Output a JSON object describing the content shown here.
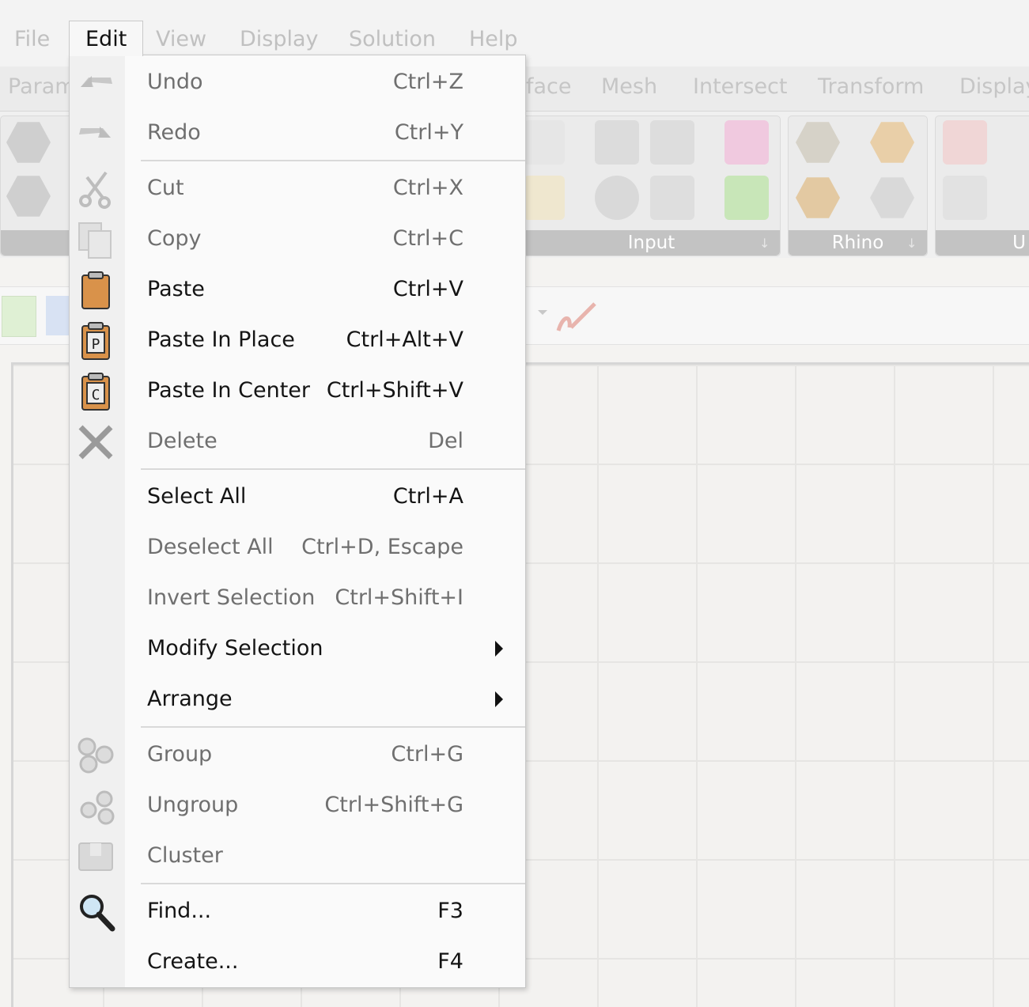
{
  "menubar": {
    "items": [
      "File",
      "Edit",
      "View",
      "Display",
      "Solution",
      "Help"
    ]
  },
  "tabs": {
    "items": [
      "Param",
      "face",
      "Mesh",
      "Intersect",
      "Transform",
      "Display"
    ]
  },
  "ribbon": {
    "panels": [
      "Input",
      "Rhino",
      "U"
    ]
  },
  "edit_menu": {
    "items": [
      {
        "label": "Undo",
        "shortcut": "Ctrl+Z",
        "enabled": false,
        "icon": "undo-icon"
      },
      {
        "label": "Redo",
        "shortcut": "Ctrl+Y",
        "enabled": false,
        "icon": "redo-icon"
      },
      {
        "label": "Cut",
        "shortcut": "Ctrl+X",
        "enabled": false,
        "icon": "scissors-icon"
      },
      {
        "label": "Copy",
        "shortcut": "Ctrl+C",
        "enabled": false,
        "icon": "copy-icon"
      },
      {
        "label": "Paste",
        "shortcut": "Ctrl+V",
        "enabled": true,
        "icon": "clipboard-icon"
      },
      {
        "label": "Paste In Place",
        "shortcut": "Ctrl+Alt+V",
        "enabled": true,
        "icon": "clipboard-p-icon"
      },
      {
        "label": "Paste In Center",
        "shortcut": "Ctrl+Shift+V",
        "enabled": true,
        "icon": "clipboard-c-icon"
      },
      {
        "label": "Delete",
        "shortcut": "Del",
        "enabled": false,
        "icon": "delete-x-icon"
      },
      {
        "label": "Select All",
        "shortcut": "Ctrl+A",
        "enabled": true,
        "icon": ""
      },
      {
        "label": "Deselect All",
        "shortcut": "Ctrl+D, Escape",
        "enabled": false,
        "icon": ""
      },
      {
        "label": "Invert Selection",
        "shortcut": "Ctrl+Shift+I",
        "enabled": false,
        "icon": ""
      },
      {
        "label": "Modify Selection",
        "shortcut": "",
        "enabled": true,
        "icon": "",
        "submenu": true
      },
      {
        "label": "Arrange",
        "shortcut": "",
        "enabled": true,
        "icon": "",
        "submenu": true
      },
      {
        "label": "Group",
        "shortcut": "Ctrl+G",
        "enabled": false,
        "icon": "group-icon"
      },
      {
        "label": "Ungroup",
        "shortcut": "Ctrl+Shift+G",
        "enabled": false,
        "icon": "ungroup-icon"
      },
      {
        "label": "Cluster",
        "shortcut": "",
        "enabled": false,
        "icon": "cluster-box-icon"
      },
      {
        "label": "Find...",
        "shortcut": "F3",
        "enabled": true,
        "icon": "magnifier-icon"
      },
      {
        "label": "Create...",
        "shortcut": "F4",
        "enabled": true,
        "icon": ""
      }
    ]
  },
  "colors": {
    "menu_bg": "#fafafa",
    "gutter_bg": "#f0f0f0",
    "enabled_text": "#141414",
    "disabled_text": "#6f6f6f",
    "panel_label_bg": "#c3c3c3",
    "canvas_bg": "#f3f2f0"
  }
}
